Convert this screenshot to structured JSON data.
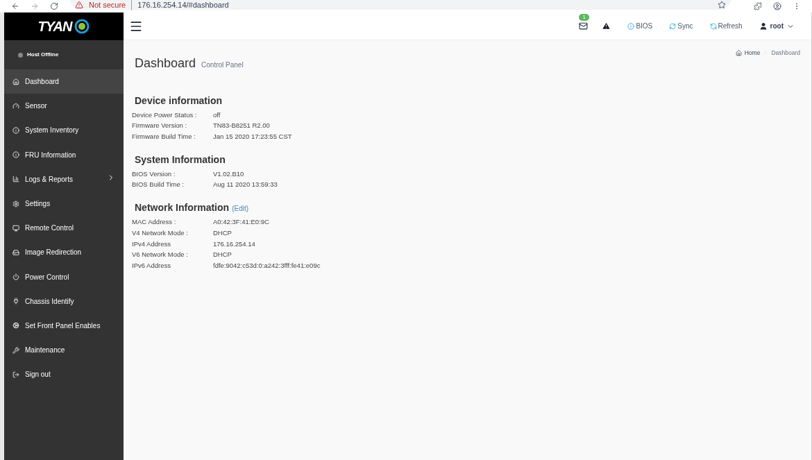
{
  "browser": {
    "security": "Not secure",
    "url": "176.16.254.14/#dashboard"
  },
  "logo": {
    "text": "TYAN"
  },
  "host_status": {
    "label": "Host Offline",
    "online": false
  },
  "sidebar": {
    "items": [
      {
        "label": "Dashboard",
        "selected": true,
        "has_submenu": false
      },
      {
        "label": "Sensor",
        "selected": false,
        "has_submenu": false
      },
      {
        "label": "System Inventory",
        "selected": false,
        "has_submenu": false
      },
      {
        "label": "FRU Information",
        "selected": false,
        "has_submenu": false
      },
      {
        "label": "Logs & Reports",
        "selected": false,
        "has_submenu": true
      },
      {
        "label": "Settings",
        "selected": false,
        "has_submenu": false
      },
      {
        "label": "Remote Control",
        "selected": false,
        "has_submenu": false
      },
      {
        "label": "Image Redirection",
        "selected": false,
        "has_submenu": false
      },
      {
        "label": "Power Control",
        "selected": false,
        "has_submenu": false
      },
      {
        "label": "Chassis Identify",
        "selected": false,
        "has_submenu": false
      },
      {
        "label": "Set Front Panel Enables",
        "selected": false,
        "has_submenu": false
      },
      {
        "label": "Maintenance",
        "selected": false,
        "has_submenu": false
      },
      {
        "label": "Sign out",
        "selected": false,
        "has_submenu": false
      }
    ]
  },
  "header": {
    "notification_count": "1",
    "actions": [
      "BIOS",
      "Sync",
      "Refresh"
    ],
    "user": "root"
  },
  "page": {
    "title": "Dashboard",
    "subtitle": "Control Panel",
    "breadcrumb": [
      "Home",
      "Dashboard"
    ]
  },
  "sections": [
    {
      "title": "Device information",
      "rows": [
        {
          "label": "Device Power Status :",
          "value": "off"
        },
        {
          "label": "Firmware Version :",
          "value": "TN83-B8251 R2.00"
        },
        {
          "label": "Firmware Build Time :",
          "value": "Jan 15 2020 17:23:55 CST"
        }
      ]
    },
    {
      "title": "System Information",
      "rows": [
        {
          "label": "BIOS Version :",
          "value": "V1.02.B10"
        },
        {
          "label": "BIOS Build Time :",
          "value": "Aug 11 2020 13:59:33"
        }
      ]
    },
    {
      "title": "Network Information",
      "link": "(Edit)",
      "rows": [
        {
          "label": "MAC Address :",
          "value": "A0:42:3F:41:E0:9C"
        },
        {
          "label": "V4 Network Mode :",
          "value": "DHCP"
        },
        {
          "label": "IPv4 Address",
          "value": "176.16.254.14"
        },
        {
          "label": "V6 Network Mode :",
          "value": "DHCP"
        },
        {
          "label": "IPv6 Address",
          "value": "fdfe:9042:c53d:0:a242:3fff:fe41:e09c"
        }
      ]
    }
  ]
}
